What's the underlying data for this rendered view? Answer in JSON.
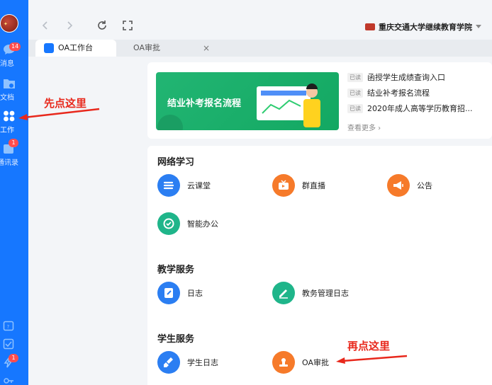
{
  "rail": {
    "items": [
      {
        "label": "消息",
        "badge": "14"
      },
      {
        "label": "文档"
      },
      {
        "label": "工作"
      },
      {
        "label": "通讯录",
        "badge": "1"
      }
    ],
    "bottom_badge": "1"
  },
  "toolbar": {
    "org_name": "重庆交通大学继续教育学院"
  },
  "tabs": [
    {
      "label": "OA工作台"
    },
    {
      "label": "OA审批",
      "close": "×"
    }
  ],
  "news": {
    "banner_title": "结业补考报名流程",
    "items": [
      {
        "tag": "已读",
        "title": "函授学生成绩查询入口"
      },
      {
        "tag": "已读",
        "title": "结业补考报名流程"
      },
      {
        "tag": "已读",
        "title": "2020年成人高等学历教育招..."
      }
    ],
    "more": "查看更多 ›"
  },
  "sections": {
    "online": {
      "title": "网络学习",
      "apps": [
        "云课堂",
        "群直播",
        "公告",
        "智能办公"
      ]
    },
    "teaching": {
      "title": "教学服务",
      "apps": [
        "日志",
        "教务管理日志"
      ]
    },
    "student": {
      "title": "学生服务",
      "apps": [
        "学生日志",
        "OA审批"
      ]
    }
  },
  "annotations": {
    "first": "先点这里",
    "second": "再点这里"
  },
  "colors": {
    "rail": "#1677ff",
    "annotation": "#e8281c",
    "app_blue": "#2b7ef2",
    "app_orange": "#f67a2a",
    "app_green": "#1fb58a"
  }
}
